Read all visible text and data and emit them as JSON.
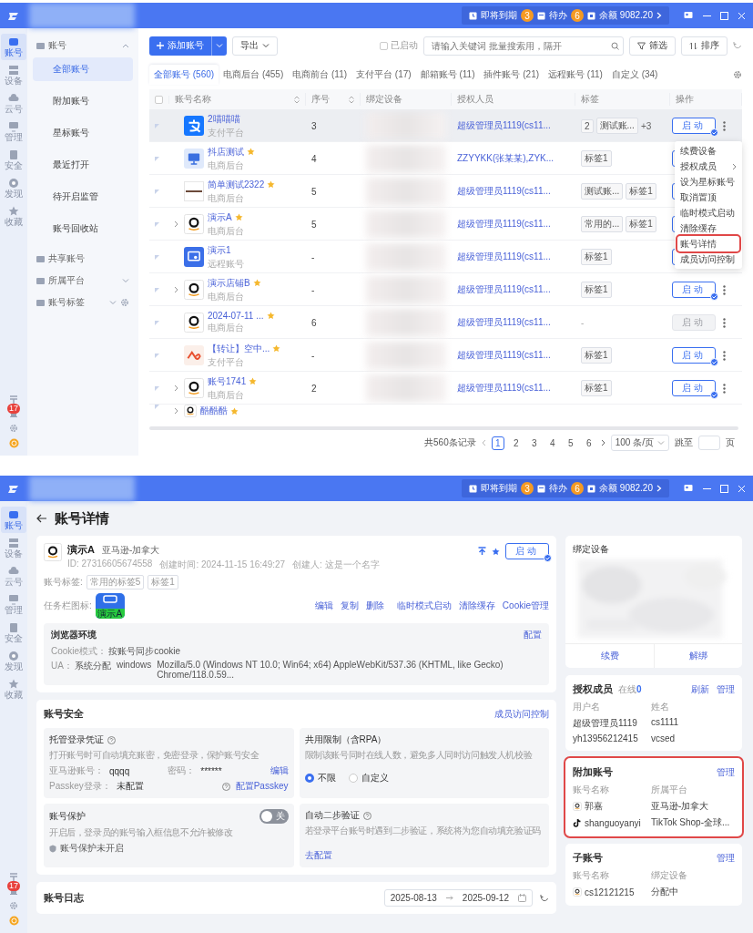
{
  "list_screen": {
    "titlebar": {
      "notices": [
        {
          "label": "即将到期",
          "count": "3"
        },
        {
          "label": "待办",
          "count": "6"
        }
      ],
      "balance": "余额 9082.20"
    },
    "rail": {
      "items": [
        {
          "label": "账号",
          "selected": true
        },
        {
          "label": "设备",
          "selected": false
        },
        {
          "label": "云号",
          "selected": false
        },
        {
          "label": "管理",
          "selected": false
        },
        {
          "label": "安全",
          "selected": false
        },
        {
          "label": "发现",
          "selected": false
        },
        {
          "label": "收藏",
          "selected": false
        }
      ],
      "badge": "17"
    },
    "nav": {
      "groups": [
        {
          "label": "账号",
          "expanded": true,
          "items": [
            {
              "label": "全部账号",
              "selected": true
            },
            {
              "label": "附加账号",
              "selected": false
            },
            {
              "label": "星标账号",
              "selected": false
            },
            {
              "label": "最近打开",
              "selected": false
            },
            {
              "label": "待开启监管",
              "selected": false
            },
            {
              "label": "账号回收站",
              "selected": false
            }
          ]
        },
        {
          "label": "共享账号"
        },
        {
          "label": "所属平台",
          "expanded": false
        },
        {
          "label": "账号标签",
          "expanded": false,
          "settings": true
        }
      ]
    },
    "toolbar": {
      "add_button": "添加账号",
      "export_button": "导出",
      "started_filter": {
        "label": "已启动",
        "checked": false
      },
      "search": {
        "placeholder": "请输入关键词 批量搜索用，隔开"
      },
      "filter_button": "筛选",
      "sort_button": "排序"
    },
    "tabs": [
      {
        "label": "全部账号 (560)",
        "selected": true
      },
      {
        "label": "电商后台 (455)",
        "selected": false
      },
      {
        "label": "电商前台 (11)",
        "selected": false
      },
      {
        "label": "支付平台 (17)",
        "selected": false
      },
      {
        "label": "邮箱账号 (11)",
        "selected": false
      },
      {
        "label": "插件账号 (21)",
        "selected": false
      },
      {
        "label": "远程账号 (11)",
        "selected": false
      },
      {
        "label": "自定义 (34)",
        "selected": false
      }
    ],
    "table": {
      "select_all": {
        "checked": false
      },
      "columns": [
        {
          "label": "账号名称",
          "sortable": true
        },
        {
          "label": "序号",
          "sortable": true
        },
        {
          "label": "绑定设备",
          "sortable": false
        },
        {
          "label": "授权人员",
          "sortable": false
        },
        {
          "label": "标签",
          "sortable": false
        },
        {
          "label": "操作",
          "sortable": false
        }
      ],
      "rows": [
        {
          "name": "2喵喵喵",
          "platform": "支付平台",
          "logo": {
            "kind": "alipay"
          },
          "starred": false,
          "expandable": false,
          "hovered": true,
          "seq": "3",
          "person": "超级管理员1119(cs11...",
          "tags": [
            "2",
            "测试账..."
          ],
          "more_tags": "+3",
          "start": {
            "label": "启动",
            "disabled": false
          }
        },
        {
          "name": "抖店测试",
          "platform": "电商后台",
          "logo": {
            "kind": "monitor"
          },
          "starred": true,
          "expandable": false,
          "hovered": false,
          "seq": "4",
          "person": "ZZYYKK(张某某),ZYK...",
          "tags": [
            "标签1"
          ],
          "start": {
            "disabled": false
          }
        },
        {
          "name": "简单测试2322",
          "platform": "电商后台",
          "logo": {
            "kind": "banner"
          },
          "starred": true,
          "expandable": false,
          "hovered": false,
          "seq": "5",
          "person": "超级管理员1119(cs11...",
          "tags": [
            "测试账...",
            "标签1"
          ],
          "start": {
            "disabled": false
          }
        },
        {
          "name": "演示A",
          "platform": "电商后台",
          "logo": {
            "kind": "amazon"
          },
          "starred": true,
          "expandable": true,
          "hovered": false,
          "seq": "5",
          "person": "超级管理员1119(cs11...",
          "tags": [
            "常用的...",
            "标签1"
          ],
          "start": {
            "disabled": false
          }
        },
        {
          "name": "演示1",
          "platform": "远程账号",
          "logo": {
            "kind": "remote"
          },
          "starred": false,
          "expandable": false,
          "hovered": false,
          "seq": "-",
          "person": "超级管理员1119(cs11...",
          "tags": [
            "标签1"
          ],
          "start": {
            "disabled": false
          }
        },
        {
          "name": "演示店铺B",
          "platform": "电商后台",
          "logo": {
            "kind": "amazon"
          },
          "starred": true,
          "expandable": true,
          "hovered": false,
          "seq": "-",
          "person": "超级管理员1119(cs11...",
          "tags": [
            "标签1"
          ],
          "start": {
            "label": "启动",
            "disabled": false
          }
        },
        {
          "name": "2024-07-11 ...",
          "platform": "电商后台",
          "logo": {
            "kind": "amazon"
          },
          "starred": true,
          "expandable": false,
          "hovered": false,
          "seq": "6",
          "person": "超级管理员1119(cs11...",
          "tags": [],
          "no_tags": "-",
          "start": {
            "label": "启动",
            "disabled": true
          }
        },
        {
          "name": "【转让】空中...",
          "platform": "支付平台",
          "logo": {
            "kind": "relay"
          },
          "starred": true,
          "expandable": false,
          "hovered": false,
          "seq": "-",
          "person": "超级管理员1119(cs11...",
          "tags": [
            "标签1"
          ],
          "start": {
            "label": "启动",
            "disabled": false
          }
        },
        {
          "name": "账号1741",
          "platform": "电商后台",
          "logo": {
            "kind": "amazon"
          },
          "starred": true,
          "expandable": true,
          "hovered": false,
          "seq": "2",
          "person": "超级管理员1119(cs11...",
          "tags": [
            "标签1"
          ],
          "start": {
            "label": "启动",
            "disabled": false
          }
        },
        {
          "name": "酷酷酷",
          "logo": {
            "kind": "amazon"
          },
          "starred": true,
          "expandable": true,
          "hovered": false,
          "tags": []
        }
      ]
    },
    "row_menu": {
      "items": [
        {
          "label": "续费设备",
          "submenu": false,
          "highlighted": false
        },
        {
          "label": "授权成员",
          "submenu": true,
          "highlighted": false
        },
        {
          "label": "设为星标账号",
          "submenu": false,
          "highlighted": false
        },
        {
          "label": "取消置顶",
          "submenu": false,
          "highlighted": false
        },
        {
          "label": "临时模式启动",
          "submenu": false,
          "highlighted": false
        },
        {
          "label": "清除缓存",
          "submenu": false,
          "highlighted": false
        },
        {
          "label": "账号详情",
          "submenu": false,
          "highlighted": true
        },
        {
          "label": "成员访问控制",
          "submenu": false,
          "highlighted": false
        }
      ]
    },
    "pagination": {
      "total": "共560条记录",
      "pages": [
        {
          "label": "1",
          "selected": true
        },
        {
          "label": "2",
          "selected": false
        },
        {
          "label": "3",
          "selected": false
        },
        {
          "label": "4",
          "selected": false
        },
        {
          "label": "5",
          "selected": false
        },
        {
          "label": "6",
          "selected": false
        }
      ],
      "page_size": "100 条/页",
      "jump_label": "跳至",
      "page_unit": "页"
    }
  },
  "detail_screen": {
    "titlebar": {
      "notices": [
        {
          "label": "即将到期",
          "count": "3"
        },
        {
          "label": "待办",
          "count": "6"
        }
      ],
      "balance": "余额 9082.20"
    },
    "rail": {
      "items": [
        {
          "label": "账号",
          "selected": true
        },
        {
          "label": "设备",
          "selected": false
        },
        {
          "label": "云号",
          "selected": false
        },
        {
          "label": "管理",
          "selected": false
        },
        {
          "label": "安全",
          "selected": false
        },
        {
          "label": "发现",
          "selected": false
        },
        {
          "label": "收藏",
          "selected": false
        }
      ],
      "badge": "17"
    },
    "page_title": "账号详情",
    "account": {
      "name": "演示A",
      "platform": "亚马逊-加拿大",
      "logo": {
        "kind": "amazon"
      },
      "meta": [
        "ID: 27316605674558",
        "创建时间: 2024-11-15 16:49:27",
        "创建人: 这是一个名字"
      ],
      "pinned": true,
      "starred": true,
      "start_button": "启动",
      "tags_label": "账号标签:",
      "tags": [
        "常用的标签5",
        "标签1"
      ],
      "taskbar_label": "任务栏图标:",
      "taskbar_icon_text": "演示A",
      "actions": [
        [
          "编辑",
          "复制",
          "删除"
        ],
        [
          "临时模式启动",
          "清除缓存",
          "Cookie管理"
        ]
      ],
      "browser_env": {
        "title": "浏览器环境",
        "config_link": "配置",
        "cookie_label": "Cookie模式：",
        "cookie_value": "按账号同步cookie",
        "ua_label": "UA：",
        "ua_values": [
          "系统分配",
          "windows",
          "Mozilla/5.0 (Windows NT 10.0; Win64; x64) AppleWebKit/537.36 (KHTML, like Gecko) Chrome/118.0.59..."
        ]
      }
    },
    "security": {
      "title": "账号安全",
      "link": "成员访问控制",
      "panels": [
        {
          "kind": "credentials",
          "title": "托管登录凭证",
          "help": true,
          "desc": "打开账号时可自动填充账密，免密登录，保护账号安全",
          "fields": [
            {
              "label": "亚马逊账号：",
              "value": "qqqq"
            },
            {
              "label": "密码：",
              "value": "******"
            }
          ],
          "edit_link": "编辑",
          "passkey_label": "Passkey登录：",
          "passkey_value": "未配置",
          "passkey_link": "配置Passkey"
        },
        {
          "kind": "limit",
          "title": "共用限制（含RPA）",
          "help": false,
          "desc": "限制该账号同时在线人数，避免多人同时访问触发人机校验",
          "options": [
            {
              "label": "不限",
              "selected": true
            },
            {
              "label": "自定义",
              "selected": false
            }
          ]
        },
        {
          "kind": "protection",
          "title": "账号保护",
          "help": false,
          "toggle": {
            "on": false,
            "label": "关"
          },
          "desc": "开启后，登录员的账号输入框信息不允许被修改",
          "status": "账号保护未开启"
        },
        {
          "kind": "two_step",
          "title": "自动二步验证",
          "help": true,
          "desc": "若登录平台账号时遇到二步验证，系统将为您自动填充验证码",
          "link": "去配置"
        }
      ]
    },
    "log": {
      "title": "账号日志",
      "start_date": "2025-08-13",
      "end_date": "2025-09-12"
    },
    "device_card": {
      "title": "绑定设备",
      "buttons": [
        "续费",
        "解绑"
      ]
    },
    "members": {
      "title": "授权成员",
      "online": "在线**0**",
      "actions": [
        "刷新",
        "管理"
      ],
      "columns": [
        "用户名",
        "姓名"
      ],
      "rows": [
        [
          "超级管理员1119",
          "cs1111"
        ],
        [
          "yh13956212415",
          "vcsed"
        ]
      ]
    },
    "extra_accounts": {
      "title": "附加账号",
      "highlighted": true,
      "actions": [
        "管理"
      ],
      "columns": [
        "账号名称",
        "所属平台"
      ],
      "rows": [
        {
          "logo": {
            "kind": "amazon"
          },
          "name": "郭嘉",
          "value": "亚马逊-加拿大"
        },
        {
          "logo": {
            "kind": "tiktok"
          },
          "name": "shanguoyanyi",
          "value": "TikTok Shop-全球..."
        }
      ]
    },
    "sub_accounts": {
      "title": "子账号",
      "highlighted": false,
      "actions": [
        "管理"
      ],
      "columns": [
        "账号名称",
        "绑定设备"
      ],
      "rows": [
        {
          "logo": {
            "kind": "amazon"
          },
          "name": "cs12121215",
          "value": "分配中"
        }
      ]
    }
  }
}
